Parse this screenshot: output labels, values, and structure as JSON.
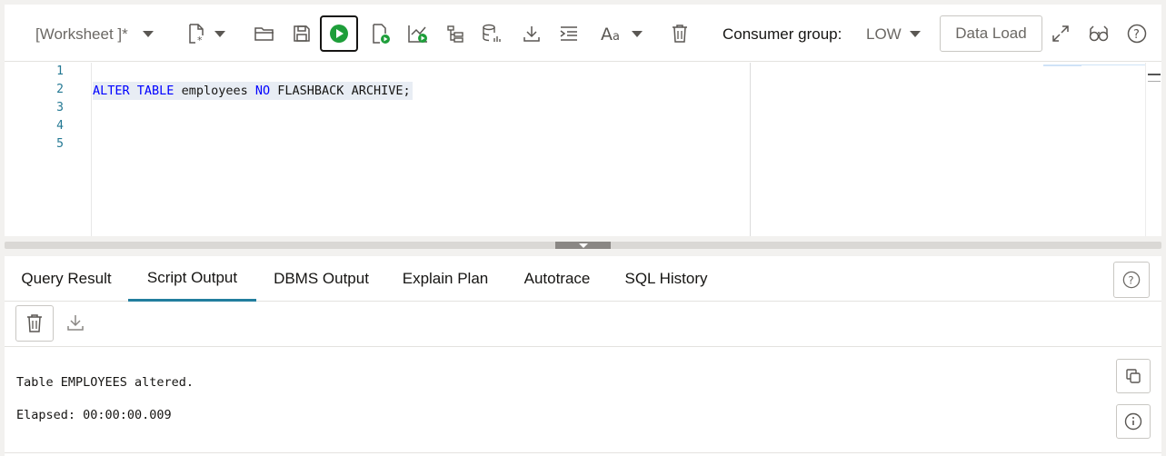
{
  "toolbar": {
    "worksheet_label": "[Worksheet ]*",
    "consumer_group_label": "Consumer group:",
    "consumer_group_value": "LOW",
    "data_load_label": "Data Load",
    "icons": [
      "new-file-icon",
      "open-folder-icon",
      "save-icon",
      "run-statement-icon",
      "run-script-icon",
      "explain-plan-icon",
      "autotrace-icon",
      "sql-tuning-icon",
      "download-icon",
      "format-icon",
      "font-size-icon",
      "clear-icon",
      "expand-icon",
      "binoculars-icon",
      "help-icon"
    ],
    "run_color": "#1e9e3a"
  },
  "editor": {
    "line_numbers": [
      "1",
      "2",
      "3",
      "4",
      "5"
    ],
    "code": {
      "t1": "ALTER",
      "t2": "TABLE",
      "t3": "employees",
      "t4": "NO",
      "t5": "FLASHBACK",
      "t6": "ARCHIVE;"
    }
  },
  "tabs": [
    {
      "label": "Query Result",
      "active": false
    },
    {
      "label": "Script Output",
      "active": true
    },
    {
      "label": "DBMS Output",
      "active": false
    },
    {
      "label": "Explain Plan",
      "active": false
    },
    {
      "label": "Autotrace",
      "active": false
    },
    {
      "label": "SQL History",
      "active": false
    }
  ],
  "output": {
    "lines": [
      "Table EMPLOYEES altered.",
      "Elapsed: 00:00:00.009"
    ]
  },
  "colors": {
    "active_tab_underline": "#227e9e",
    "keyword": "#0000ff"
  }
}
